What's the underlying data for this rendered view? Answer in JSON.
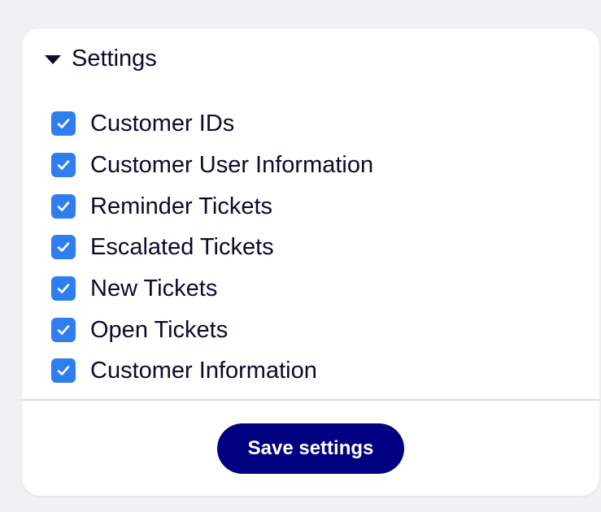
{
  "settings": {
    "title": "Settings",
    "expanded": true,
    "toggle_icon": "caret-down-icon",
    "options": [
      {
        "label": "Customer IDs",
        "checked": true
      },
      {
        "label": "Customer User Information",
        "checked": true
      },
      {
        "label": "Reminder Tickets",
        "checked": true
      },
      {
        "label": "Escalated Tickets",
        "checked": true
      },
      {
        "label": "New Tickets",
        "checked": true
      },
      {
        "label": "Open Tickets",
        "checked": true
      },
      {
        "label": "Customer Information",
        "checked": true
      }
    ],
    "save_label": "Save settings"
  },
  "colors": {
    "accent": "#2f7ef0",
    "button": "#000080",
    "text": "#0d0a2c",
    "background": "#f1f1f3",
    "panel": "#ffffff"
  }
}
